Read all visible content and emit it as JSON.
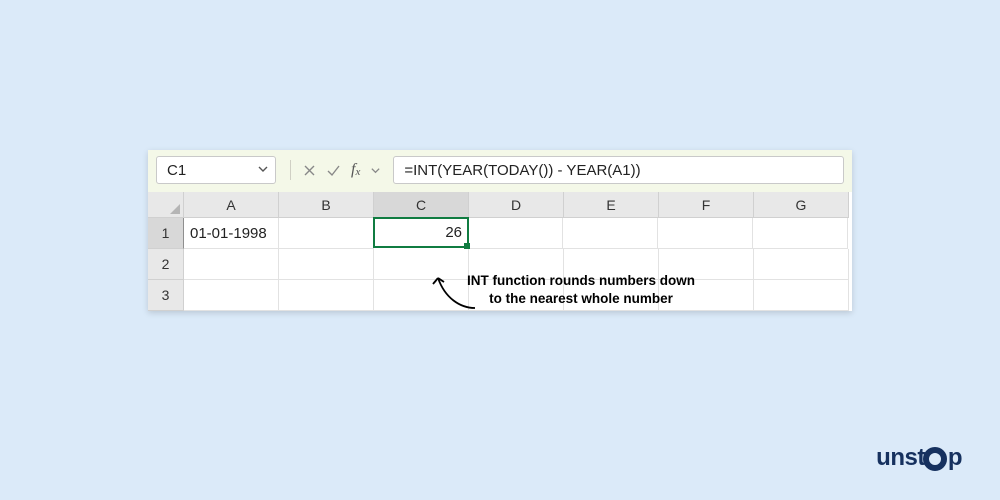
{
  "nameBox": {
    "value": "C1"
  },
  "formulaBar": {
    "value": "=INT(YEAR(TODAY()) - YEAR(A1))"
  },
  "columns": [
    "A",
    "B",
    "C",
    "D",
    "E",
    "F",
    "G"
  ],
  "rows": [
    "1",
    "2",
    "3"
  ],
  "selected": {
    "cell": "C1",
    "column": "C",
    "row": "1"
  },
  "cells": {
    "A1": "01-01-1998",
    "C1": "26"
  },
  "annotation": {
    "text": "INT function rounds numbers down to the nearest whole number"
  },
  "brand": {
    "prefix": "unst",
    "suffix": "p"
  }
}
